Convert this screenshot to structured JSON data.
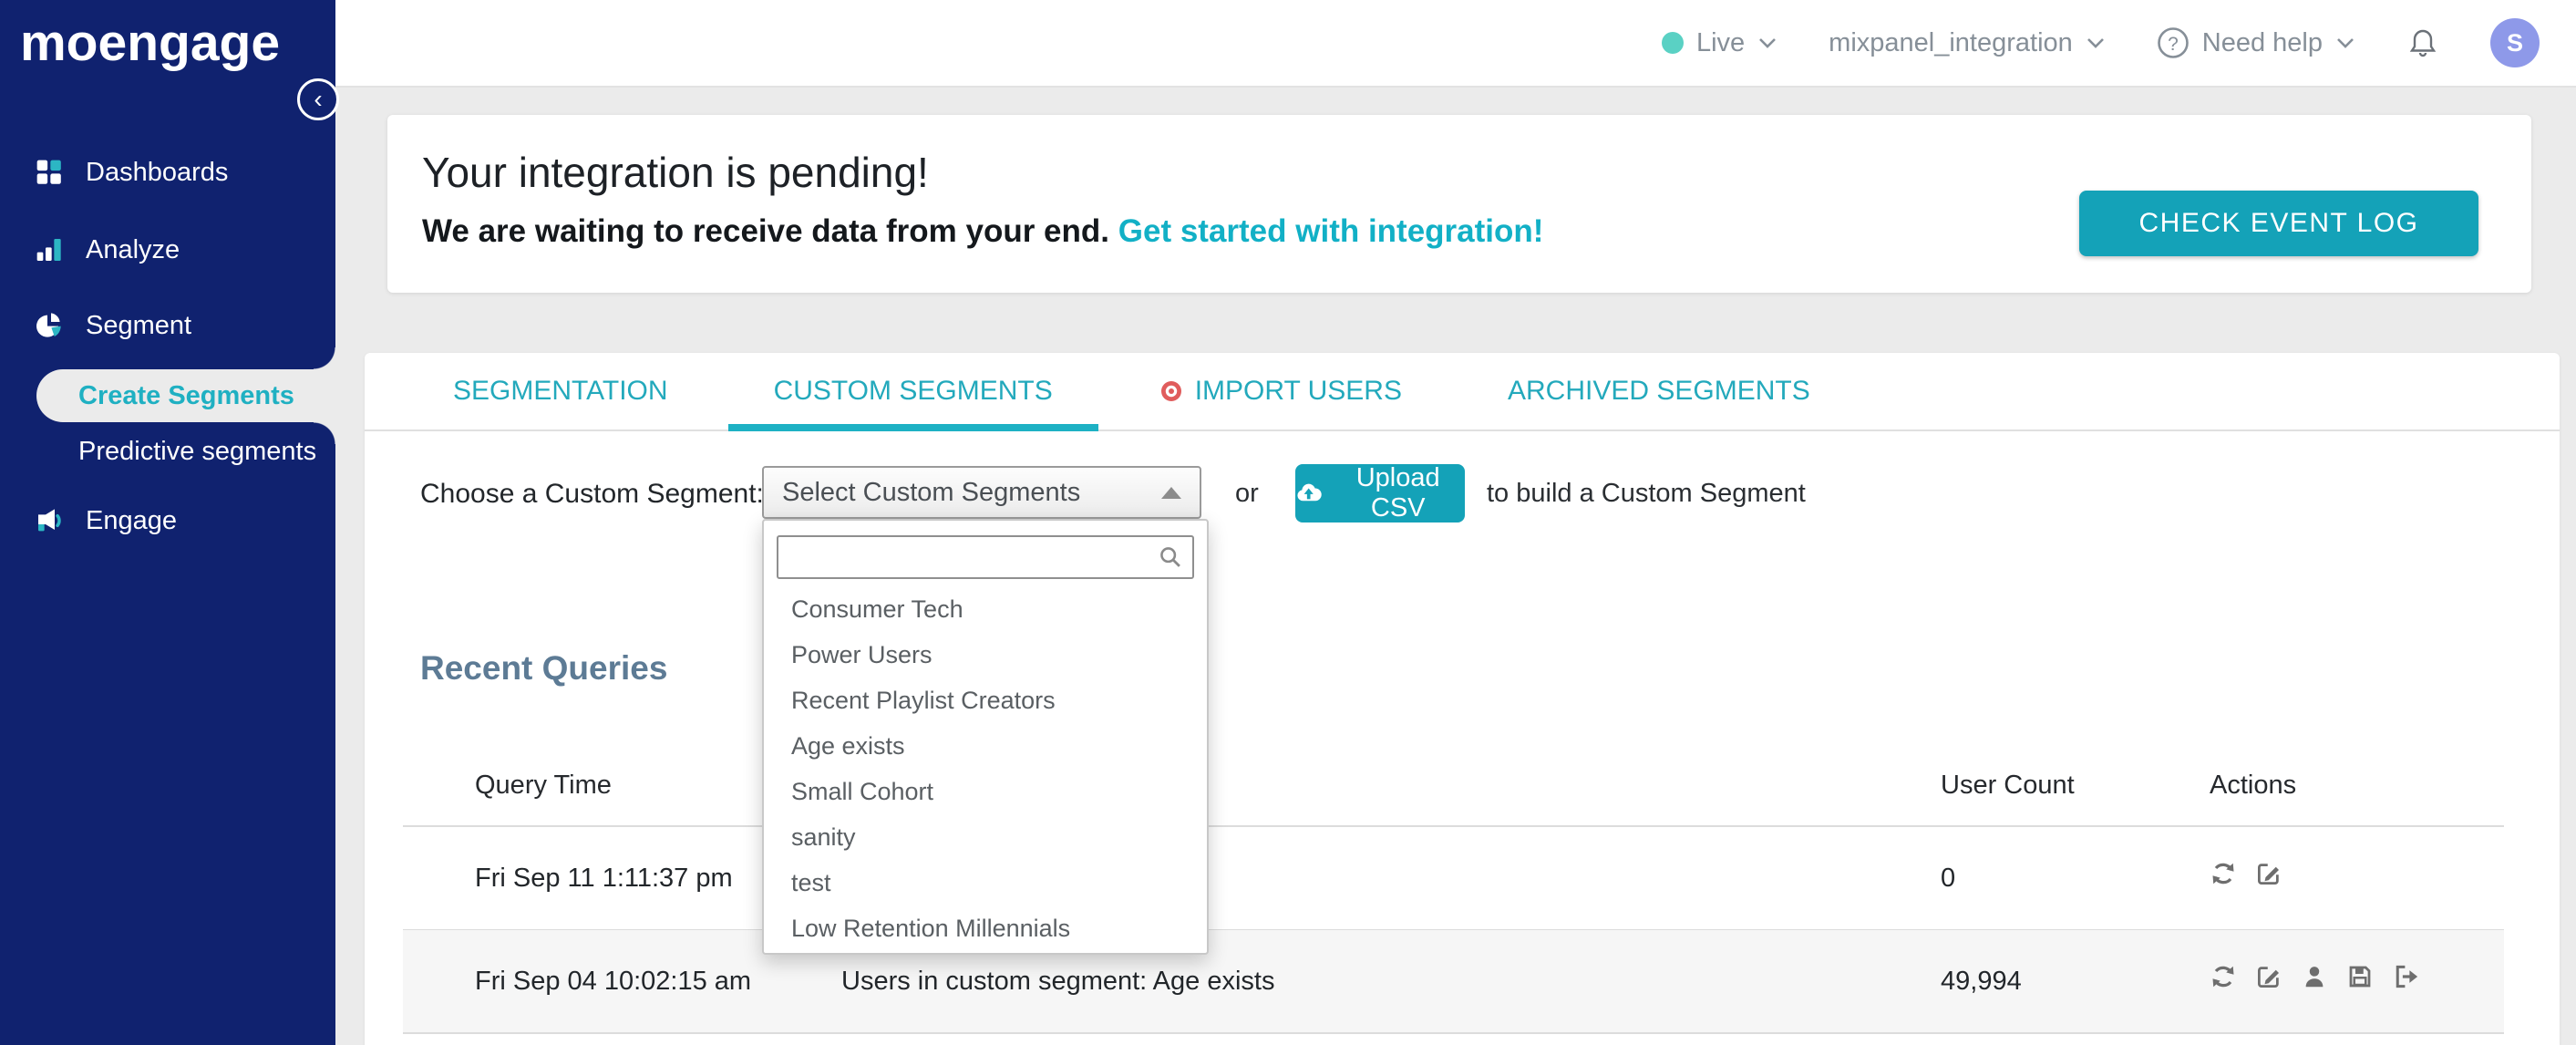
{
  "app": {
    "logo_text": "moengage"
  },
  "topbar": {
    "environment": {
      "label": "Live"
    },
    "workspace": {
      "label": "mixpanel_integration"
    },
    "help": {
      "label": "Need help"
    },
    "avatar_initial": "S"
  },
  "sidebar": {
    "items": [
      {
        "label": "Dashboards",
        "icon": "dashboards-icon"
      },
      {
        "label": "Analyze",
        "icon": "analyze-icon"
      },
      {
        "label": "Segment",
        "icon": "segment-icon"
      },
      {
        "label": "Create Segments",
        "active": true
      },
      {
        "label": "Predictive segments"
      },
      {
        "label": "Engage",
        "icon": "engage-icon"
      }
    ]
  },
  "banner": {
    "title": "Your integration is pending!",
    "subtitle": "We are waiting to receive data from your end.",
    "link_text": "Get started with integration!",
    "button_label": "CHECK EVENT LOG"
  },
  "tabs": [
    {
      "label": "SEGMENTATION",
      "active": false
    },
    {
      "label": "CUSTOM SEGMENTS",
      "active": true
    },
    {
      "label": "IMPORT USERS",
      "active": false,
      "badge": "red-target-dot"
    },
    {
      "label": "ARCHIVED SEGMENTS",
      "active": false
    }
  ],
  "segment_picker": {
    "label": "Choose a Custom Segment:",
    "select_value": "Select Custom Segments",
    "search_value": "",
    "or_text": "or",
    "upload_button_label": "Upload CSV",
    "suffix_text": "to build a Custom Segment",
    "options": [
      "Consumer Tech",
      "Power Users",
      "Recent Playlist Creators",
      "Age exists",
      "Small Cohort",
      "sanity",
      "test",
      "Low Retention Millennials"
    ]
  },
  "recent_queries": {
    "title": "Recent Queries",
    "columns": {
      "time": "Query Time",
      "count": "User Count",
      "actions": "Actions"
    },
    "rows": [
      {
        "time": "Fri Sep 11 1:11:37 pm",
        "description": "",
        "user_count": "0",
        "actions": [
          "refresh",
          "edit"
        ]
      },
      {
        "time": "Fri Sep 04 10:02:15 am",
        "description": "Users in custom segment: Age exists",
        "user_count": "49,994",
        "actions": [
          "refresh",
          "edit",
          "user",
          "save",
          "export"
        ]
      }
    ]
  },
  "colors": {
    "sidebar_navy": "#10226f",
    "accent_teal": "#14a2b8",
    "tab_teal": "#23a9bc",
    "link_teal": "#12b0c6",
    "live_dot": "#5ad1c4",
    "avatar_bg": "#8e99e9",
    "import_dot_red": "#e05c5c",
    "heading_slate": "#5d7b95",
    "page_bg": "#ebebeb",
    "row_stripe": "#f6f6f6"
  }
}
